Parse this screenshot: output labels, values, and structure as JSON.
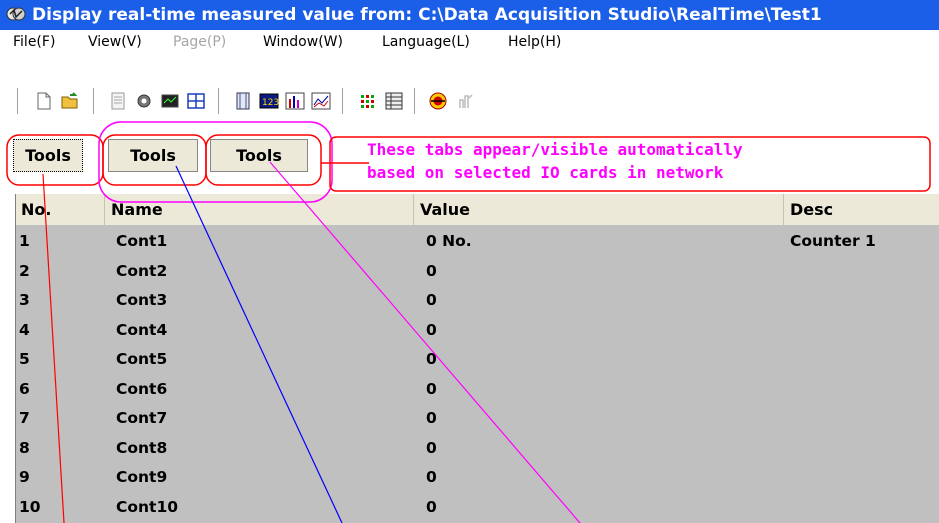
{
  "window": {
    "title": "Display real-time measured value from: C:\\Data Acquisition Studio\\RealTime\\Test1"
  },
  "menu": [
    {
      "label": "File(F)",
      "enabled": true
    },
    {
      "label": "View(V)",
      "enabled": true
    },
    {
      "label": "Page(P)",
      "enabled": false
    },
    {
      "label": "Window(W)",
      "enabled": true
    },
    {
      "label": "Language(L)",
      "enabled": true
    },
    {
      "label": "Help(H)",
      "enabled": true
    }
  ],
  "toolbar": {
    "icons": [
      "new-file-icon",
      "open-folder-icon",
      "page-icon",
      "settings-gear-icon",
      "monitor-icon",
      "table-grid-icon",
      "panel-icon",
      "digital-display-icon",
      "bar-chart-icon",
      "line-chart-icon",
      "dots-grid-icon",
      "list-grid-icon",
      "stop-record-icon",
      "tool-icon"
    ]
  },
  "tabs": [
    {
      "label": "Tools",
      "selected": true
    },
    {
      "label": "Tools",
      "selected": false
    },
    {
      "label": "Tools",
      "selected": false
    }
  ],
  "annotation": {
    "line1": "These tabs appear/visible automatically",
    "line2": "based on selected IO cards in network",
    "color": "#ff00ff"
  },
  "table": {
    "columns": [
      "No.",
      "Name",
      "Value",
      "Desc"
    ],
    "rows": [
      {
        "no": "1",
        "name": "Cont1",
        "value": "0 No.",
        "desc": "Counter 1"
      },
      {
        "no": "2",
        "name": "Cont2",
        "value": "0",
        "desc": ""
      },
      {
        "no": "3",
        "name": "Cont3",
        "value": "0",
        "desc": ""
      },
      {
        "no": "4",
        "name": "Cont4",
        "value": "0",
        "desc": ""
      },
      {
        "no": "5",
        "name": "Cont5",
        "value": "0",
        "desc": ""
      },
      {
        "no": "6",
        "name": "Cont6",
        "value": "0",
        "desc": ""
      },
      {
        "no": "7",
        "name": "Cont7",
        "value": "0",
        "desc": ""
      },
      {
        "no": "8",
        "name": "Cont8",
        "value": "0",
        "desc": ""
      },
      {
        "no": "9",
        "name": "Cont9",
        "value": "0",
        "desc": ""
      },
      {
        "no": "10",
        "name": "Cont10",
        "value": "0",
        "desc": ""
      }
    ]
  },
  "colors": {
    "titlebar": "#1b5ee8",
    "grid_background": "#c0c0c0",
    "header_background": "#ece9d8",
    "callout_red": "#ff0000",
    "callout_magenta": "#ff00ff",
    "callout_blue": "#0000ff"
  }
}
